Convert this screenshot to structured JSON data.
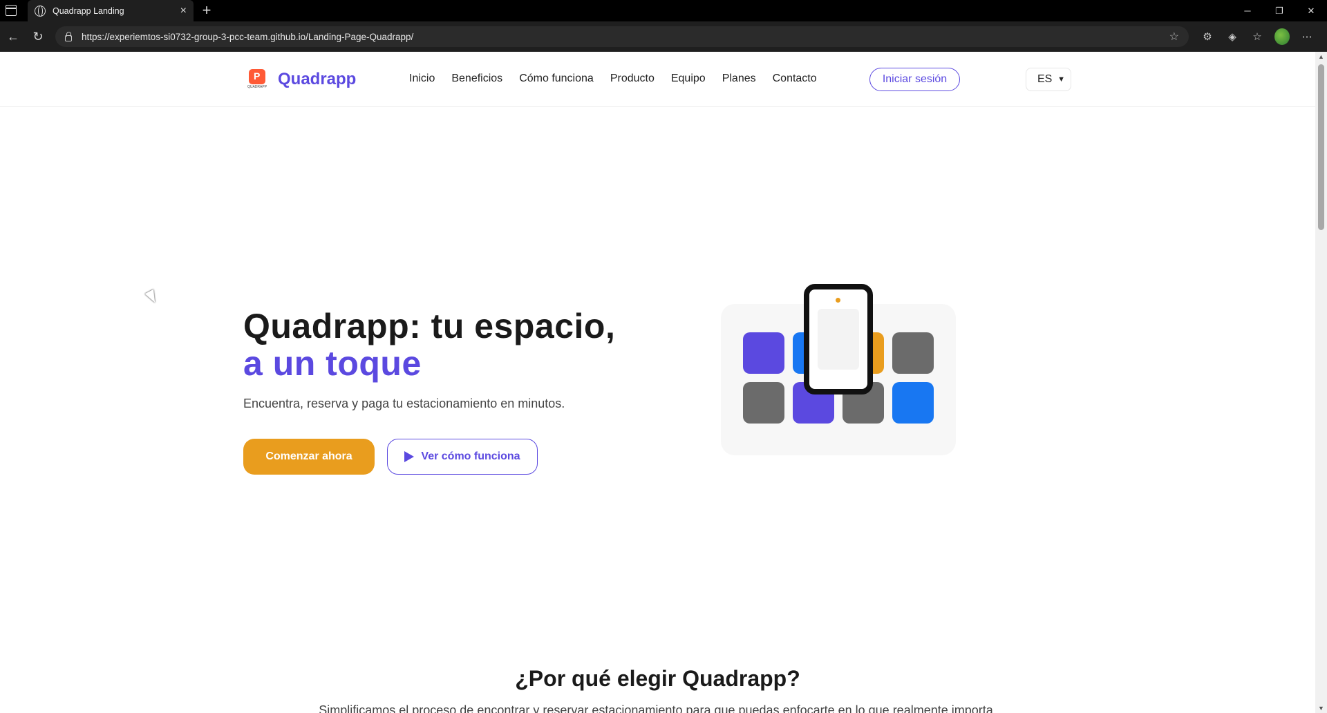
{
  "browser": {
    "tab_title": "Quadrapp Landing",
    "url": "https://experiemtos-si0732-group-3-pcc-team.github.io/Landing-Page-Quadrapp/"
  },
  "header": {
    "brand": "Quadrapp",
    "logo_small": "QUADRAPP",
    "nav": [
      "Inicio",
      "Beneficios",
      "Cómo funciona",
      "Producto",
      "Equipo",
      "Planes",
      "Contacto"
    ],
    "login_label": "Iniciar sesión",
    "language": "ES"
  },
  "hero": {
    "title_part1": "Quadrapp: tu espacio,",
    "title_accent": "a un toque",
    "subtitle": "Encuentra, reserva y paga tu estacionamiento en minutos.",
    "primary_cta": "Comenzar ahora",
    "secondary_cta": "Ver cómo funciona"
  },
  "why": {
    "title": "¿Por qué elegir Quadrapp?",
    "subtitle": "Simplificamos el proceso de encontrar y reservar estacionamiento para que puedas enfocarte en lo que realmente importa."
  },
  "colors": {
    "brand": "#5b49e0",
    "accent": "#e99d1e",
    "blue": "#1877f2",
    "gray": "#6b6b6b"
  }
}
